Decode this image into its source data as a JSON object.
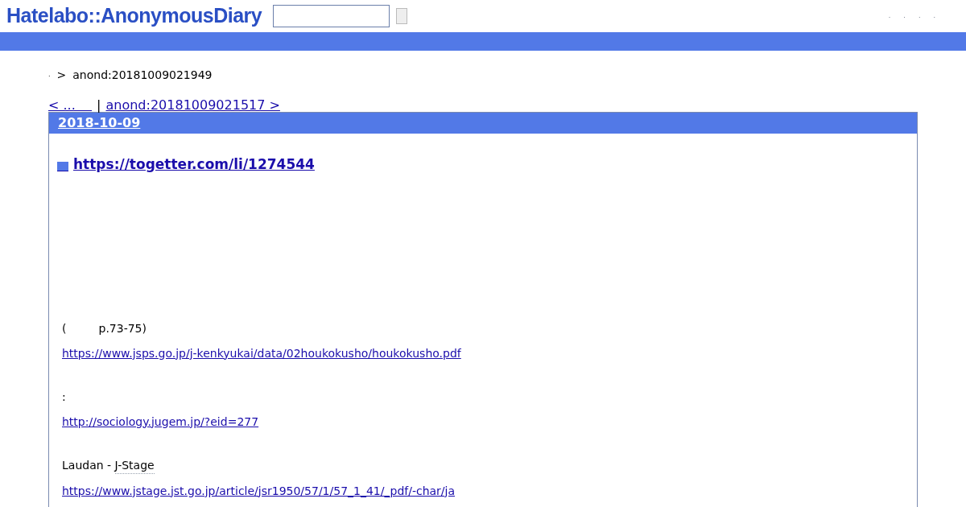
{
  "header": {
    "logo": "Hatelabo::AnonymousDiary",
    "nav_links": [
      ".",
      ".",
      ".",
      "."
    ]
  },
  "breadcrumb": {
    "home": ".",
    "separator": ">",
    "current": "anond:20181009021949"
  },
  "pager": {
    "prev": "< ...    ",
    "divider": "|",
    "next": "anond:20181009021517 >"
  },
  "entry": {
    "date": "2018-10-09",
    "title": "https://togetter.com/li/1274544",
    "paragraphs": [
      {
        "kind": "text",
        "text": "(         p.73-75)"
      },
      {
        "kind": "link",
        "text": "https://www.jsps.go.jp/j-kenkyukai/data/02houkokusho/houkokusho.pdf"
      },
      {
        "kind": "spacer"
      },
      {
        "kind": "text",
        "text": ":"
      },
      {
        "kind": "link",
        "text": "http://sociology.jugem.jp/?eid=277"
      },
      {
        "kind": "spacer"
      },
      {
        "kind": "cite",
        "text": "Laudan - ",
        "cite": "J-Stage"
      },
      {
        "kind": "link",
        "text": "https://www.jstage.jst.go.jp/article/jsr1950/57/1/57_1_41/_pdf/-char/ja"
      }
    ]
  }
}
